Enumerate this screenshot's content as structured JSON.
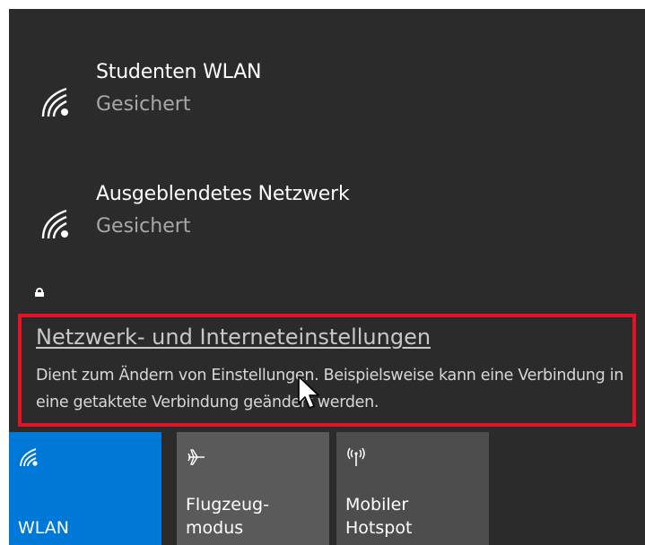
{
  "networks": [
    {
      "name": "Studenten WLAN",
      "status": "Gesichert",
      "icon": "wifi-icon"
    },
    {
      "name": "Ausgeblendetes Netzwerk",
      "status": "Gesichert",
      "icon": "wifi-icon"
    }
  ],
  "settings": {
    "link": "Netzwerk- und Interneteinstellungen",
    "description": "Dient zum Ändern von Einstellungen. Beispielsweise kann eine Verbindung in eine getaktete Verbindung geändert werden.",
    "highlight_color": "#e81123"
  },
  "tiles": [
    {
      "label": "WLAN",
      "icon": "wifi-icon",
      "active": true,
      "color": "#0078d7"
    },
    {
      "label": "Flugzeug-\nmodus",
      "icon": "airplane-icon",
      "active": false
    },
    {
      "label": "Mobiler\nHotspot",
      "icon": "hotspot-icon",
      "active": false
    }
  ],
  "colors": {
    "flyout_bg": "#2b2b2b",
    "accent": "#0078d7"
  }
}
